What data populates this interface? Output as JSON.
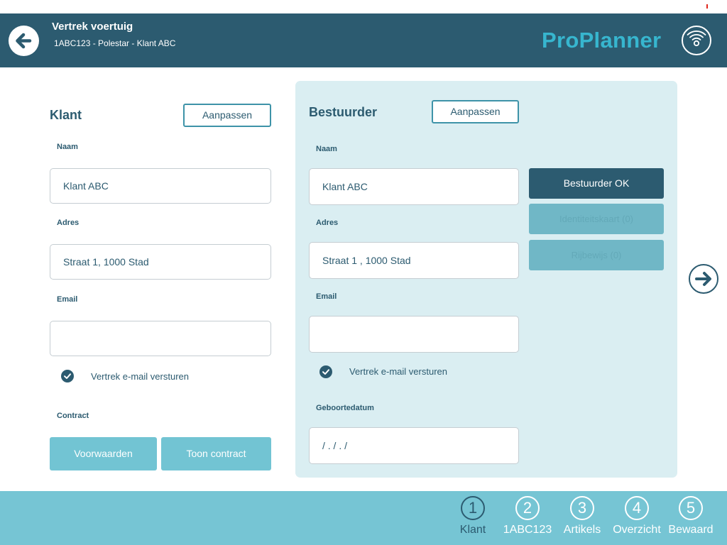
{
  "header": {
    "title": "Vertrek voertuig",
    "subtitle": "1ABC123 -  Polestar - Klant ABC",
    "logo": "ProPlanner",
    "back_icon": "back-arrow-icon",
    "logo_icon": "wifi-icon"
  },
  "klant": {
    "title": "Klant",
    "edit_label": "Aanpassen",
    "name_label": "Naam",
    "name_value": "Klant ABC",
    "address_label": "Adres",
    "address_value": "Straat 1, 1000 Stad",
    "email_label": "Email",
    "email_value": "",
    "send_mail_label": "Vertrek e-mail versturen",
    "send_mail_checked": true,
    "contract_label": "Contract",
    "terms_button": "Voorwaarden",
    "contract_button": "Toon contract"
  },
  "bestuurder": {
    "title": "Bestuurder",
    "edit_label": "Aanpassen",
    "name_label": "Naam",
    "name_value": "Klant ABC",
    "address_label": "Adres",
    "address_value": "Straat 1 , 1000 Stad",
    "email_label": "Email",
    "email_value": "",
    "send_mail_label": "Vertrek e-mail versturen",
    "send_mail_checked": true,
    "birthdate_label": "Geboortedatum",
    "birthdate_value": " / . / . /",
    "ok_button": "Bestuurder OK",
    "id_card_button": "Identiteitskaart (0)",
    "license_button": "Rijbewijs (0)"
  },
  "next_icon": "arrow-right-circle-icon",
  "steps": [
    {
      "number": "1",
      "label": "Klant",
      "active": true
    },
    {
      "number": "2",
      "label": "1ABC123",
      "active": false
    },
    {
      "number": "3",
      "label": "Artikels",
      "active": false
    },
    {
      "number": "4",
      "label": "Overzicht",
      "active": false
    },
    {
      "number": "5",
      "label": "Bewaard",
      "active": false
    }
  ],
  "colors": {
    "header_bg": "#2c5b70",
    "accent": "#37b6cf",
    "panel_bg": "#daeef2",
    "bottom_bar": "#76c5d4"
  }
}
